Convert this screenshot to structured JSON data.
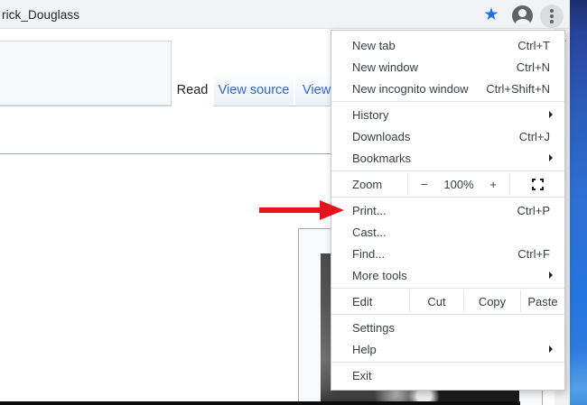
{
  "browser": {
    "toolbar": {
      "address_text": "rick_Douglass"
    }
  },
  "page": {
    "tabs": [
      {
        "label": "Read",
        "active": true
      },
      {
        "label": "View source",
        "active": false
      },
      {
        "label": "View",
        "active": false
      }
    ]
  },
  "menu": {
    "items": [
      {
        "label": "New tab",
        "shortcut": "Ctrl+T"
      },
      {
        "label": "New window",
        "shortcut": "Ctrl+N"
      },
      {
        "label": "New incognito window",
        "shortcut": "Ctrl+Shift+N"
      },
      {
        "label": "History",
        "submenu": true
      },
      {
        "label": "Downloads",
        "shortcut": "Ctrl+J"
      },
      {
        "label": "Bookmarks",
        "submenu": true
      },
      {
        "label": "Print...",
        "shortcut": "Ctrl+P"
      },
      {
        "label": "Cast..."
      },
      {
        "label": "Find...",
        "shortcut": "Ctrl+F"
      },
      {
        "label": "More tools",
        "submenu": true
      },
      {
        "label": "Settings"
      },
      {
        "label": "Help",
        "submenu": true
      },
      {
        "label": "Exit"
      }
    ],
    "zoom_row": {
      "label": "Zoom",
      "decrease": "−",
      "level": "100%",
      "increase": "+"
    },
    "edit_row": {
      "label": "Edit",
      "cut": "Cut",
      "copy": "Copy",
      "paste": "Paste"
    }
  },
  "colors": {
    "arrow_red": "#e8131d",
    "bookmark_star_blue": "#1a73e8",
    "wiki_link_blue": "#3366cc",
    "toolbar_gray": "#f1f3f4"
  }
}
